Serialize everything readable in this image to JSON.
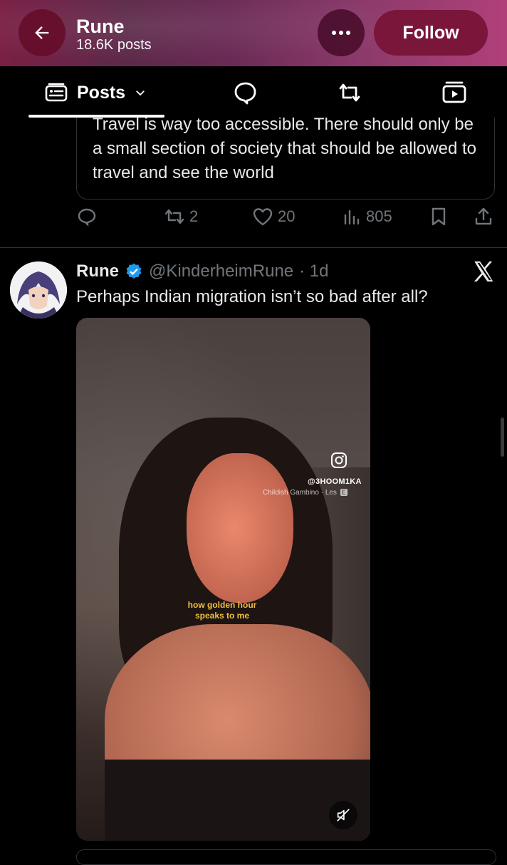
{
  "header": {
    "name": "Rune",
    "post_count": "18.6K posts",
    "follow_label": "Follow"
  },
  "tabs": {
    "posts_label": "Posts"
  },
  "quoted_tweet": {
    "text": "Travel is way too accessible. There should only be a small section of society that should be allowed to travel and see the world"
  },
  "actions": {
    "retweets": "2",
    "likes": "20",
    "views": "805"
  },
  "tweet": {
    "display_name": "Rune",
    "handle": "@KinderheimRune",
    "time": "· 1d",
    "text": "Perhaps Indian migration isn’t so bad after all?",
    "media": {
      "ig_handle": "@3HOOM1KA",
      "song": "Childish Gambino · Les",
      "explicit_badge": "E",
      "caption": "how golden hour speaks to me"
    }
  }
}
